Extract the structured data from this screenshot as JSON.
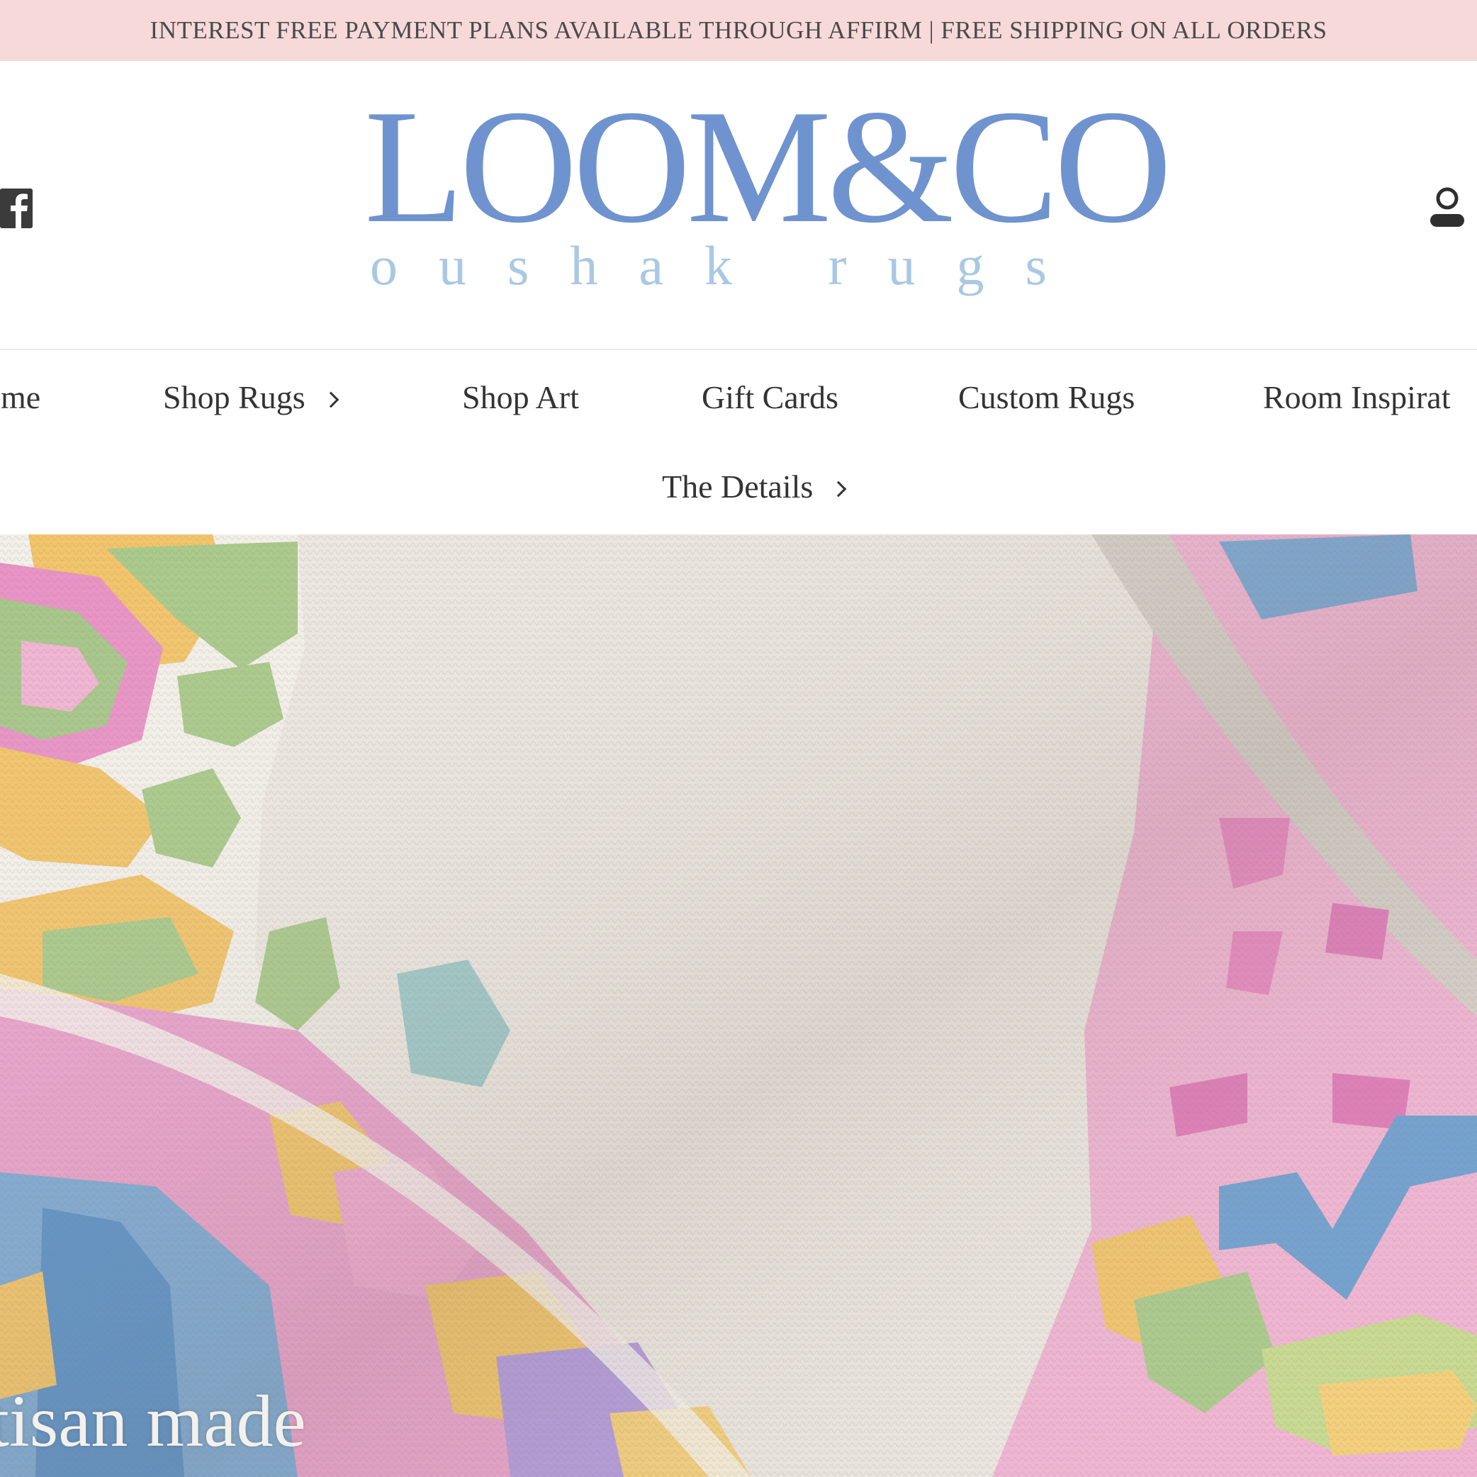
{
  "announcement": {
    "text": "INTEREST FREE PAYMENT PLANS AVAILABLE THROUGH AFFIRM | FREE SHIPPING ON ALL ORDERS"
  },
  "header": {
    "logo_main": "LOOM&CO",
    "logo_sub": "oushak rugs",
    "social_icon": "facebook-icon",
    "account_icon": "user-account-icon"
  },
  "nav": {
    "items": [
      {
        "label": "ome",
        "has_submenu": false
      },
      {
        "label": "Shop Rugs",
        "has_submenu": true
      },
      {
        "label": "Shop Art",
        "has_submenu": false
      },
      {
        "label": "Gift Cards",
        "has_submenu": false
      },
      {
        "label": "Custom Rugs",
        "has_submenu": false
      },
      {
        "label": "Room Inspirat",
        "has_submenu": false
      },
      {
        "label": "The Details",
        "has_submenu": true
      }
    ]
  },
  "hero": {
    "caption": "tisan made"
  },
  "colors": {
    "announcement_bg": "#f7d9d9",
    "logo_blue": "#6f93cf",
    "logo_sub_blue": "#a9c8e4",
    "nav_text": "#333333"
  }
}
